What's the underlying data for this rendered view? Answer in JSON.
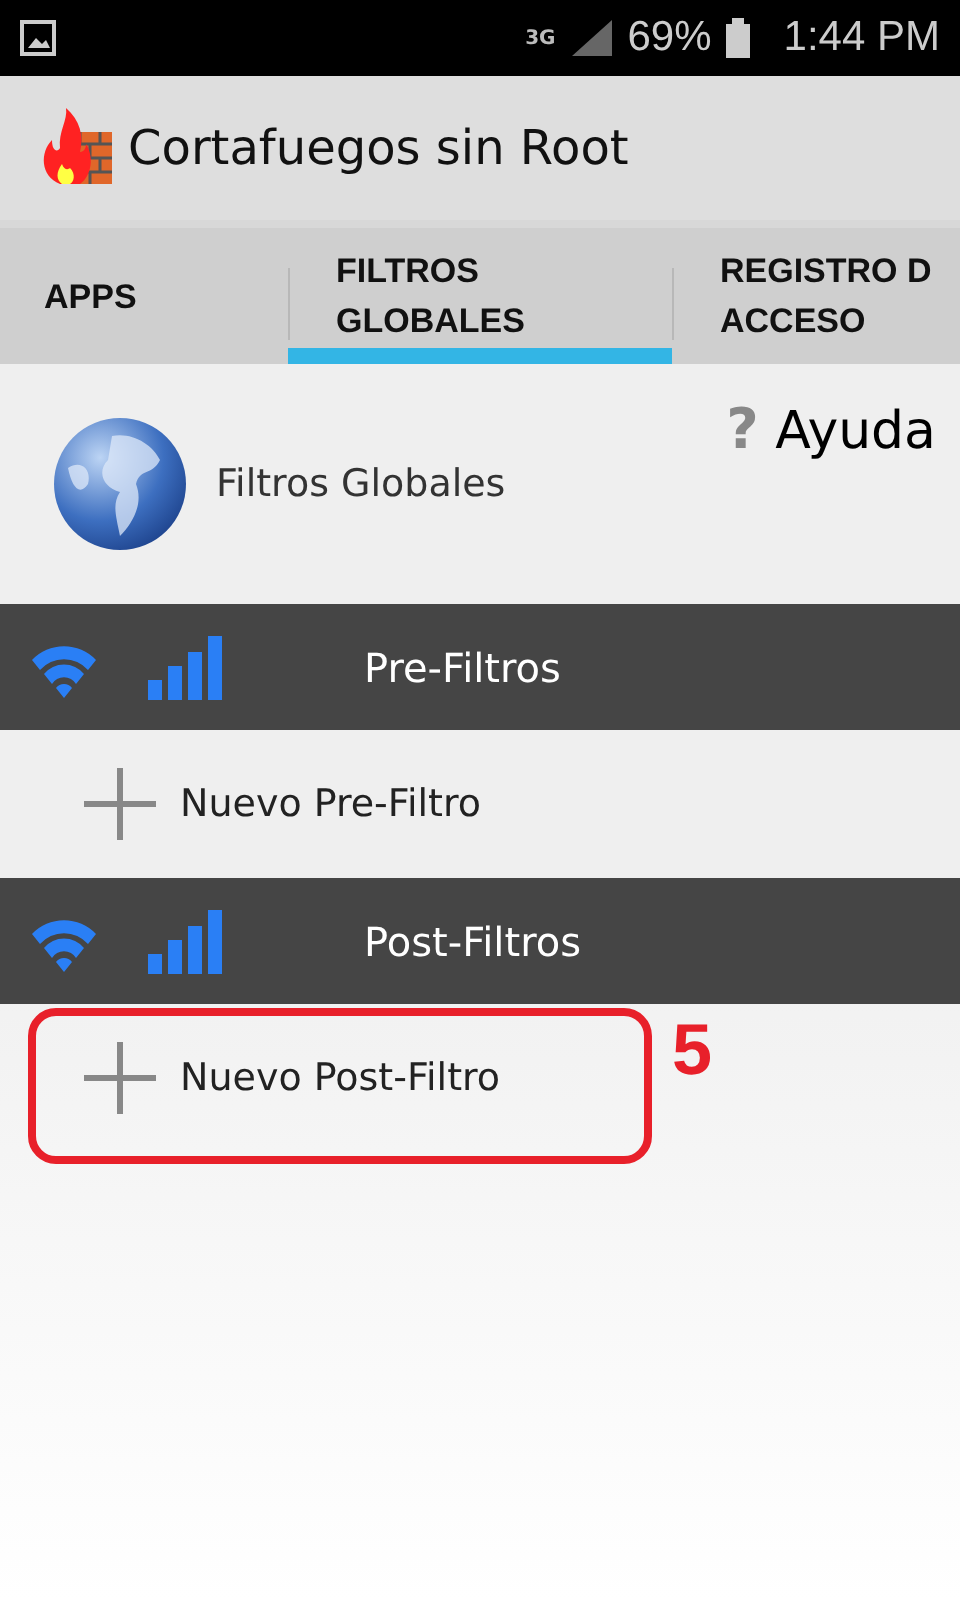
{
  "status_bar": {
    "network": "3G",
    "battery": "69%",
    "time": "1:44 PM"
  },
  "app_bar": {
    "title": "Cortafuegos sin Root"
  },
  "tabs": [
    {
      "lines": [
        "APPS"
      ],
      "selected": false
    },
    {
      "lines": [
        "FILTROS",
        "GLOBALES"
      ],
      "selected": true
    },
    {
      "lines": [
        "REGISTRO D",
        "ACCESO"
      ],
      "selected": false
    }
  ],
  "header": {
    "title": "Filtros Globales",
    "help_icon": "?",
    "help": "Ayuda"
  },
  "sections": [
    {
      "title": "Pre-Filtros",
      "add_label": "Nuevo Pre-Filtro",
      "highlighted": false
    },
    {
      "title": "Post-Filtros",
      "add_label": "Nuevo Post-Filtro",
      "highlighted": true,
      "step": "5"
    }
  ]
}
